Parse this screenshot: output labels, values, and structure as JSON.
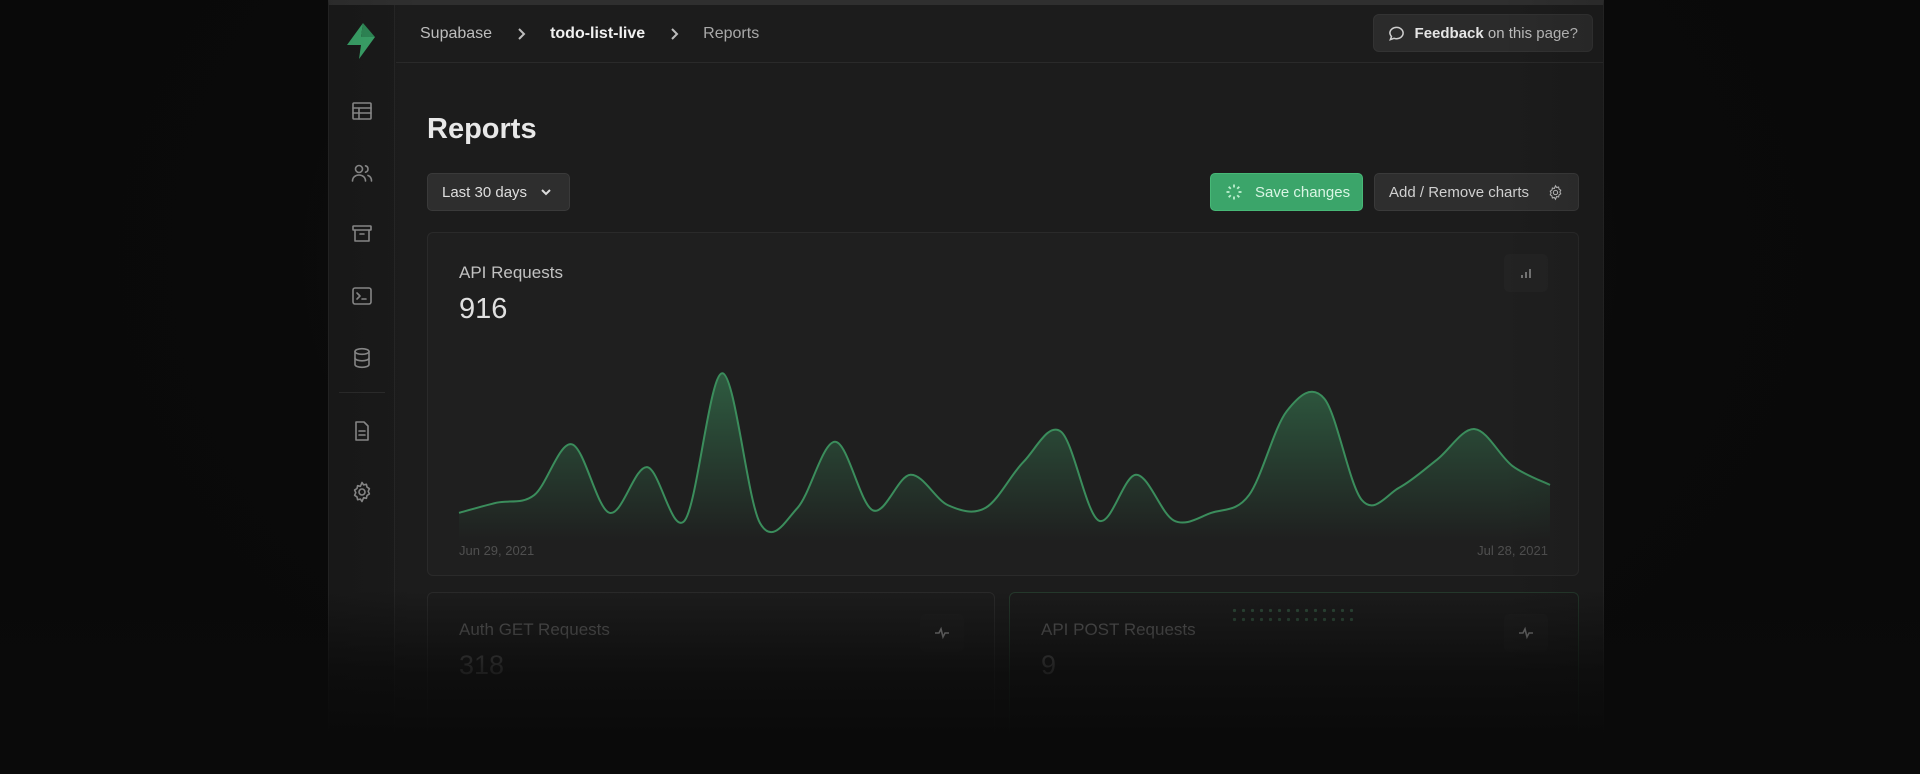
{
  "breadcrumb": {
    "org": "Supabase",
    "project": "todo-list-live",
    "page": "Reports"
  },
  "feedback": {
    "strong": "Feedback",
    "rest": " on this page?"
  },
  "page_title": "Reports",
  "toolbar": {
    "range_label": "Last 30 days",
    "save_label": "Save changes",
    "charts_label": "Add / Remove charts"
  },
  "sidebar": {
    "items": [
      {
        "icon": "table-icon"
      },
      {
        "icon": "users-icon"
      },
      {
        "icon": "archive-icon"
      },
      {
        "icon": "terminal-icon"
      },
      {
        "icon": "database-icon"
      },
      {
        "icon": "document-icon"
      },
      {
        "icon": "gear-icon"
      }
    ]
  },
  "cards": {
    "main": {
      "label": "API Requests",
      "value": "916",
      "start_date": "Jun 29, 2021",
      "end_date": "Jul 28, 2021"
    },
    "auth_get": {
      "label": "Auth GET Requests",
      "value": "318"
    },
    "api_post": {
      "label": "API POST Requests",
      "value": "9"
    }
  },
  "colors": {
    "accent": "#3ba56a",
    "chart_line": "#3b8d5c",
    "background": "#1c1c1c"
  },
  "chart_data": {
    "type": "area",
    "x": [
      "Jun 29",
      "Jun 30",
      "Jul 1",
      "Jul 2",
      "Jul 3",
      "Jul 4",
      "Jul 5",
      "Jul 6",
      "Jul 7",
      "Jul 8",
      "Jul 9",
      "Jul 10",
      "Jul 11",
      "Jul 12",
      "Jul 13",
      "Jul 14",
      "Jul 15",
      "Jul 16",
      "Jul 17",
      "Jul 18",
      "Jul 19",
      "Jul 20",
      "Jul 21",
      "Jul 22",
      "Jul 23",
      "Jul 24",
      "Jul 25",
      "Jul 26",
      "Jul 27",
      "Jul 28"
    ],
    "values": [
      8,
      16,
      22,
      62,
      8,
      44,
      2,
      118,
      0,
      12,
      64,
      10,
      38,
      14,
      12,
      48,
      72,
      2,
      38,
      2,
      8,
      22,
      88,
      98,
      18,
      28,
      50,
      74,
      45,
      30
    ],
    "series": [
      {
        "values": [
          8,
          16,
          22,
          62,
          8,
          44,
          2,
          118,
          0,
          12,
          64,
          10,
          38,
          14,
          12,
          48,
          72,
          2,
          38,
          2,
          8,
          22,
          88,
          98,
          18,
          28,
          50,
          74,
          45,
          30
        ]
      }
    ],
    "xlabel": "",
    "ylabel": "",
    "ylim": [
      0,
      130
    ],
    "grid": false,
    "legend": "none",
    "tick_labels": [
      "Jun 29, 2021",
      "Jul 28, 2021"
    ]
  }
}
